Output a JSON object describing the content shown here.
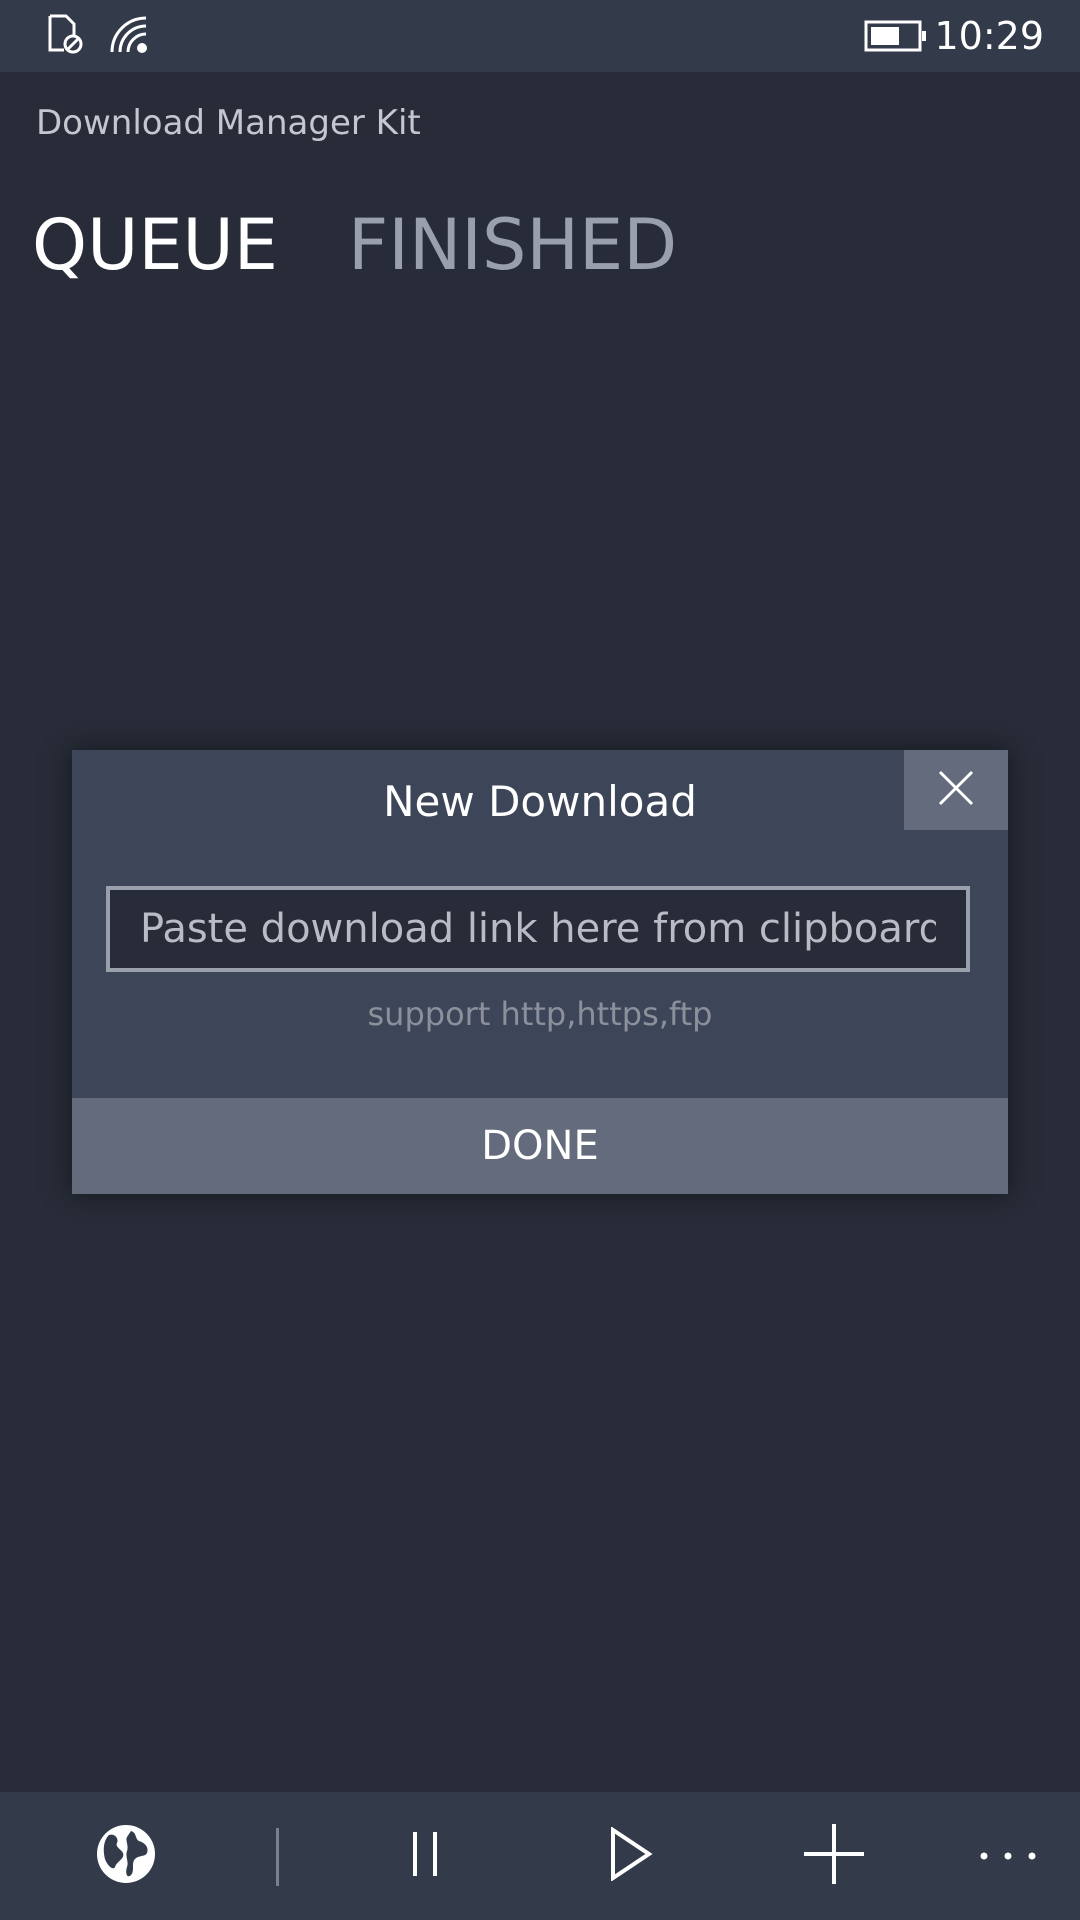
{
  "status_bar": {
    "time": "10:29",
    "icons": [
      "no-sim-icon",
      "wifi-icon",
      "battery-icon"
    ]
  },
  "app": {
    "title": "Download Manager Kit"
  },
  "tabs": [
    {
      "label": "QUEUE",
      "active": true
    },
    {
      "label": "FINISHED",
      "active": false
    }
  ],
  "dialog": {
    "title": "New Download",
    "input_value": "",
    "input_placeholder": "Paste download link here from clipboard",
    "hint": "support http,https,ftp",
    "done_label": "DONE",
    "close_icon": "close-icon"
  },
  "app_bar": {
    "buttons": [
      "globe-icon",
      "pause-icon",
      "play-icon",
      "add-icon",
      "more-icon"
    ]
  },
  "colors": {
    "background": "#272c38",
    "bars": "#333a4a",
    "dialog": "#3d4559",
    "button": "#646b7c",
    "inactive_tab": "#9aa0ab"
  }
}
